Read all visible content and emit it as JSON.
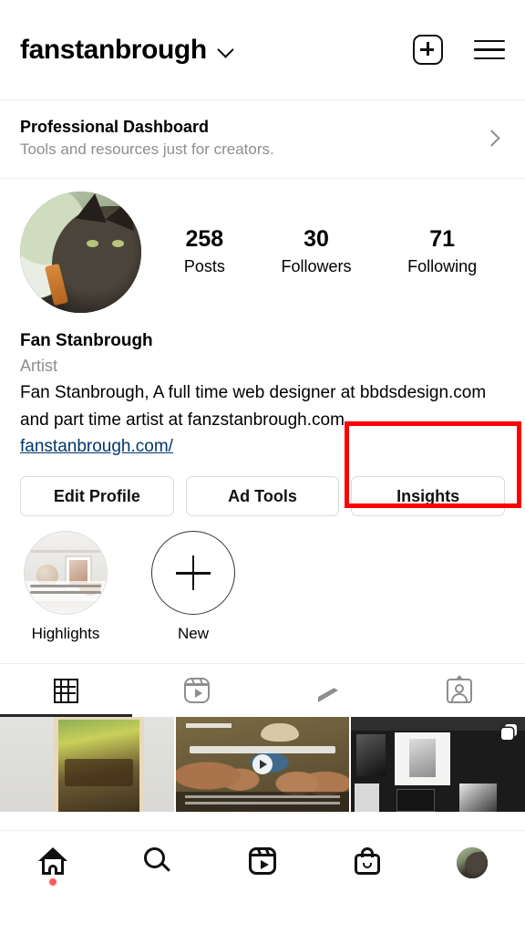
{
  "header": {
    "username": "fanstanbrough",
    "dropdown_icon": "chevron-down-icon",
    "create_icon": "plus-square-icon",
    "menu_icon": "hamburger-menu-icon"
  },
  "professional_dashboard": {
    "title": "Professional Dashboard",
    "subtitle": "Tools and resources just for creators.",
    "chevron_icon": "chevron-right-icon"
  },
  "profile": {
    "avatar_alt": "profile-photo-cat",
    "stats": [
      {
        "value": "258",
        "label": "Posts"
      },
      {
        "value": "30",
        "label": "Followers"
      },
      {
        "value": "71",
        "label": "Following"
      }
    ],
    "display_name": "Fan Stanbrough",
    "category": "Artist",
    "bio_line_1": "Fan Stanbrough, A full time web designer at bbdsdesign.com",
    "bio_line_2": "and part time artist at fanzstanbrough.com.",
    "website": "fanstanbrough.com/",
    "link_color": "#00376b"
  },
  "actions": {
    "edit_profile": "Edit Profile",
    "ad_tools": "Ad Tools",
    "insights": "Insights",
    "highlight_color": "#fe0000",
    "highlighted_button": "Insights"
  },
  "highlights": [
    {
      "label": "Highlights",
      "type": "story-highlight"
    },
    {
      "label": "New",
      "type": "add-new-highlight"
    }
  ],
  "tabs": [
    {
      "name": "grid",
      "icon": "grid-icon",
      "active": true
    },
    {
      "name": "reels",
      "icon": "reels-icon",
      "active": false
    },
    {
      "name": "igtv",
      "icon": "play-triangle-icon",
      "active": false
    },
    {
      "name": "tagged",
      "icon": "tagged-person-icon",
      "active": false
    }
  ],
  "posts": [
    {
      "id": "post-1",
      "type": "image",
      "description": "framed-landscape-artwork"
    },
    {
      "id": "post-2",
      "type": "video",
      "description": "documentary-video-thumbnail",
      "badge": "play-icon"
    },
    {
      "id": "post-3",
      "type": "carousel",
      "description": "dark-gallery-wall",
      "badge": "multi-photo-icon"
    }
  ],
  "bottom_nav": [
    {
      "name": "home",
      "icon": "home-icon",
      "badge": true,
      "badge_color": "#ff5a5f"
    },
    {
      "name": "search",
      "icon": "search-icon",
      "badge": false
    },
    {
      "name": "reels",
      "icon": "reels-icon",
      "badge": false
    },
    {
      "name": "shop",
      "icon": "shopping-bag-icon",
      "badge": false
    },
    {
      "name": "profile",
      "icon": "profile-avatar-icon",
      "badge": false
    }
  ]
}
